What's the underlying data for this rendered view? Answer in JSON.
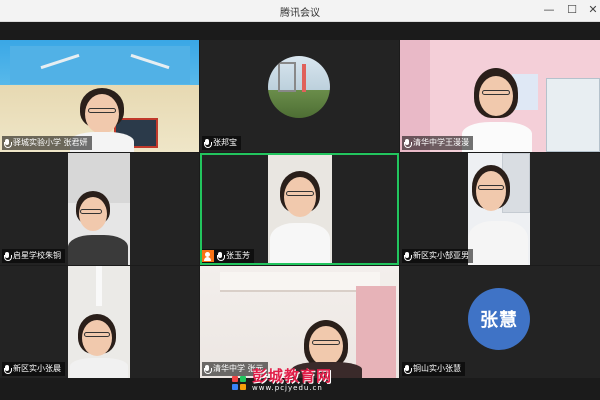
{
  "window": {
    "title": "腾讯会议"
  },
  "tiles": [
    {
      "name": "驿城实验小学 张君妍"
    },
    {
      "name": "张邦宝"
    },
    {
      "name": "清华中学王漫漫"
    },
    {
      "name": "启星学校朱铜"
    },
    {
      "name": "张玉芳"
    },
    {
      "name": "新区实小郜亚男"
    },
    {
      "name": "新区实小张晨"
    },
    {
      "name": "清华中学 张元"
    },
    {
      "name": "铜山实小张慧",
      "avatar_text": "张慧"
    }
  ],
  "watermark": {
    "title": "彭城教育网",
    "url": "www.pcjyedu.cn"
  },
  "colors": {
    "active_border": "#22c55e",
    "avatar_blue": "#3f73c6",
    "speaker_badge": "#f97316"
  }
}
